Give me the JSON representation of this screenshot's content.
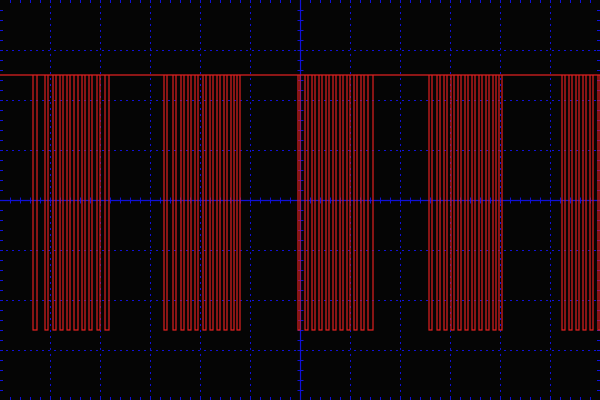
{
  "colors": {
    "background": "#050505",
    "grid": "#1010d8",
    "trace": "#e02020"
  },
  "chart_data": {
    "type": "line",
    "title": "",
    "xlabel": "",
    "ylabel": "",
    "grid": true,
    "xlim": [
      0,
      12
    ],
    "ylim": [
      -4,
      4
    ],
    "grid_divisions": {
      "x": 12,
      "y": 8
    },
    "levels": {
      "high": 2.5,
      "low": -2.6
    },
    "series": [
      {
        "bursts": [
          {
            "pulses": [
              [
                0.66,
                0.74
              ],
              [
                0.9,
                0.96
              ],
              [
                1.06,
                1.12
              ],
              [
                1.2,
                1.26
              ],
              [
                1.34,
                1.4
              ],
              [
                1.48,
                1.56
              ],
              [
                1.64,
                1.7
              ],
              [
                1.78,
                1.84
              ],
              [
                1.94,
                2.0
              ],
              [
                2.1,
                2.18
              ]
            ]
          },
          {
            "pulses": [
              [
                3.28,
                3.34
              ],
              [
                3.46,
                3.52
              ],
              [
                3.62,
                3.68
              ],
              [
                3.76,
                3.82
              ],
              [
                3.9,
                3.96
              ],
              [
                4.06,
                4.12
              ],
              [
                4.2,
                4.26
              ],
              [
                4.34,
                4.4
              ],
              [
                4.48,
                4.54
              ],
              [
                4.62,
                4.68
              ],
              [
                4.74,
                4.8
              ]
            ]
          },
          {
            "pulses": [
              [
                5.96,
                6.0
              ],
              [
                6.1,
                6.16
              ],
              [
                6.24,
                6.3
              ],
              [
                6.38,
                6.44
              ],
              [
                6.52,
                6.58
              ],
              [
                6.66,
                6.72
              ],
              [
                6.8,
                6.86
              ],
              [
                6.94,
                7.0
              ],
              [
                7.08,
                7.14
              ],
              [
                7.22,
                7.28
              ],
              [
                7.36,
                7.46
              ]
            ]
          },
          {
            "pulses": [
              [
                8.58,
                8.64
              ],
              [
                8.74,
                8.8
              ],
              [
                8.88,
                8.94
              ],
              [
                9.02,
                9.08
              ],
              [
                9.16,
                9.22
              ],
              [
                9.3,
                9.36
              ],
              [
                9.44,
                9.5
              ],
              [
                9.58,
                9.64
              ],
              [
                9.72,
                9.78
              ],
              [
                9.86,
                9.92
              ],
              [
                9.98,
                10.04
              ]
            ]
          },
          {
            "pulses": [
              [
                11.24,
                11.3
              ],
              [
                11.38,
                11.44
              ],
              [
                11.52,
                11.58
              ],
              [
                11.66,
                11.72
              ],
              [
                11.8,
                11.86
              ],
              [
                11.96,
                12.0
              ]
            ]
          }
        ]
      }
    ]
  }
}
